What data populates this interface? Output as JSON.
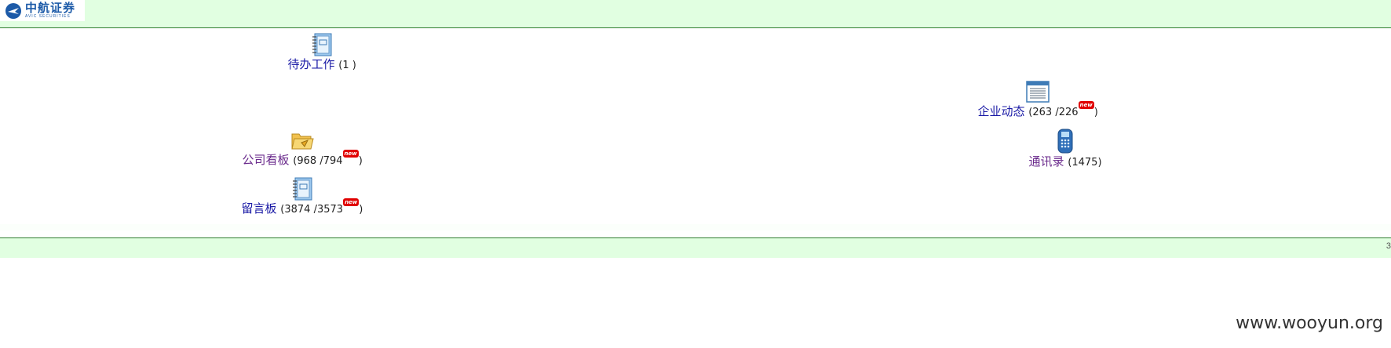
{
  "header": {
    "logo_cn": "中航证券",
    "logo_en": "AVIC SECURITIES"
  },
  "items": {
    "todo": {
      "label": "待办工作",
      "counts": "(1 )",
      "icon": "notebook-icon"
    },
    "board": {
      "label": "公司看板",
      "counts": "(968 /794",
      "suffix": ")",
      "badge": "new",
      "icon": "folder-icon"
    },
    "message": {
      "label": "留言板",
      "counts": "(3874 /3573",
      "suffix": ")",
      "badge": "new",
      "icon": "notebook-icon"
    },
    "news": {
      "label": "企业动态",
      "counts": "(263 /226",
      "suffix": ")",
      "badge": "new",
      "icon": "document-list-icon"
    },
    "contacts": {
      "label": "通讯录",
      "counts": "(1475)",
      "icon": "phone-icon"
    }
  },
  "status": {
    "right_digit": "3"
  },
  "watermark": "www.wooyun.org",
  "colors": {
    "bar": "#e1ffe1",
    "border": "#2f7d2f",
    "link": "#1a1aa6",
    "visited": "#6a2a8c"
  }
}
